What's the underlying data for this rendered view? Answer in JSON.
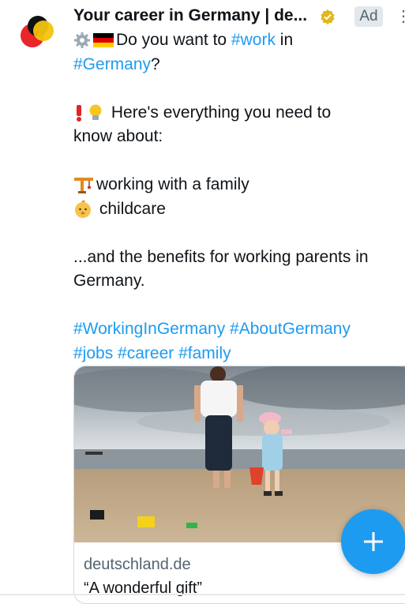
{
  "post": {
    "author": "Your career in Germany | de...",
    "ad_label": "Ad",
    "more_icon": "more-dots-icon",
    "lines": [
      {
        "pre": "",
        "parts": [
          {
            "t": "Do you want to ",
            "tag": false
          },
          {
            "t": "#work",
            "tag": true
          },
          {
            "t": " in",
            "tag": false
          }
        ]
      },
      {
        "parts": [
          {
            "t": "#Germany",
            "tag": true
          },
          {
            "t": "?",
            "tag": false
          }
        ]
      }
    ],
    "l1_text": "Do you want to ",
    "l1_tag": "#work",
    "l1_end": " in",
    "l2_tag": "#Germany",
    "l2_end": "?",
    "l3_text": "Here's everything you need to",
    "l4_text": "know about:",
    "l5_text": "working with a family",
    "l6_text": "childcare",
    "l7_text": "...and the benefits for working parents in",
    "l8_text": "Germany.",
    "tag_a": "#WorkingInGermany",
    "tag_b": "#AboutGermany",
    "tag_c": "#jobs",
    "tag_d": "#career",
    "tag_e": "#family"
  },
  "card": {
    "domain": "deutschland.de",
    "title": "“A wonderful gift”"
  },
  "colors": {
    "link": "#1d9bf0",
    "text": "#0f1419",
    "secondary": "#536471",
    "fab": "#1d9bf0"
  }
}
